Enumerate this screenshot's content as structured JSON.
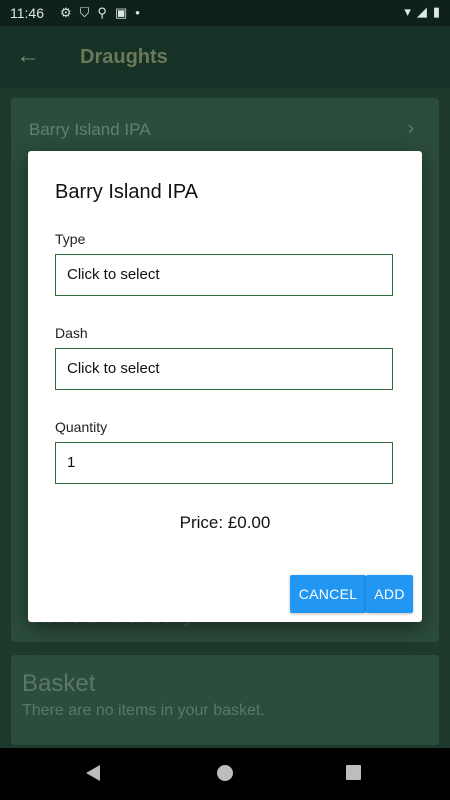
{
  "status_bar": {
    "time": "11:46",
    "left_icons": [
      "gear-icon",
      "shield-icon",
      "location-icon",
      "image-icon",
      "dot-icon"
    ],
    "right_icons": [
      "wifi-icon",
      "signal-icon",
      "battery-icon"
    ]
  },
  "app_bar": {
    "title": "Draughts",
    "back_icon": "arrow-left-icon"
  },
  "background_list": {
    "first_item": "Barry Island IPA",
    "last_item": "Stowford Mixed Berry"
  },
  "basket": {
    "title": "Basket",
    "empty_text": "There are no items in your basket."
  },
  "dialog": {
    "title": "Barry Island IPA",
    "type": {
      "label": "Type",
      "value": "Click to select"
    },
    "dash": {
      "label": "Dash",
      "value": "Click to select"
    },
    "quantity": {
      "label": "Quantity",
      "value": "1"
    },
    "price_text": "Price: £0.00",
    "cancel_label": "CANCEL",
    "add_label": "ADD"
  },
  "colors": {
    "accent": "#2196f3",
    "field_border": "#2d6b3a",
    "background": "#1d3a2c"
  }
}
